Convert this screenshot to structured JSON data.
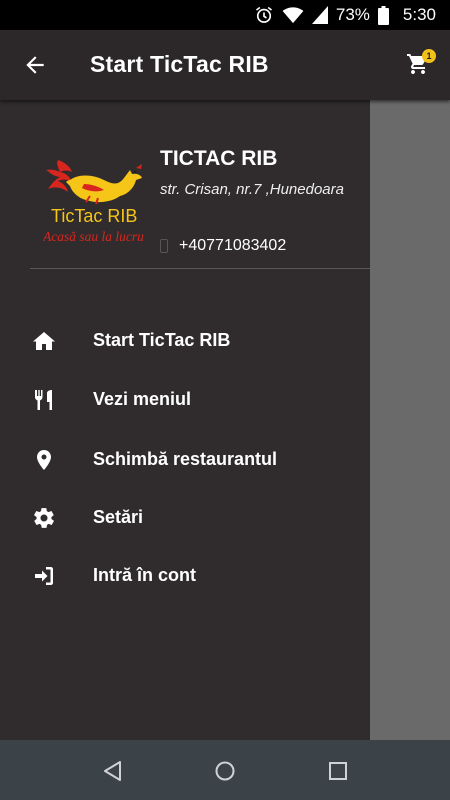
{
  "status_bar": {
    "battery": "73%",
    "time": "5:30",
    "icons": [
      "alarm-icon",
      "wifi-icon",
      "signal-icon",
      "battery-icon"
    ]
  },
  "app_bar": {
    "title": "Start TicTac RIB",
    "cart_badge": "1"
  },
  "drawer": {
    "logo": {
      "brand": "TicTac RIB",
      "tagline": "Acasă sau la lucru"
    },
    "restaurant_name": "TICTAC RIB",
    "address": "str. Crisan, nr.7 ,Hunedoara",
    "phone": "+40771083402",
    "menu": [
      {
        "label": "Start TicTac RIB",
        "icon": "home-icon"
      },
      {
        "label": "Vezi meniul",
        "icon": "cutlery-icon"
      },
      {
        "label": "Schimbă restaurantul",
        "icon": "location-pin-icon"
      },
      {
        "label": "Setări",
        "icon": "gear-icon"
      },
      {
        "label": "Intră în cont",
        "icon": "sign-in-icon"
      }
    ]
  },
  "colors": {
    "drawer_bg": "#302c2d",
    "app_bar_bg": "#2c2829",
    "badge": "#f2c01d",
    "nav_bar": "#3b4248",
    "logo_red": "#d8261f",
    "logo_yellow": "#f5c518"
  }
}
